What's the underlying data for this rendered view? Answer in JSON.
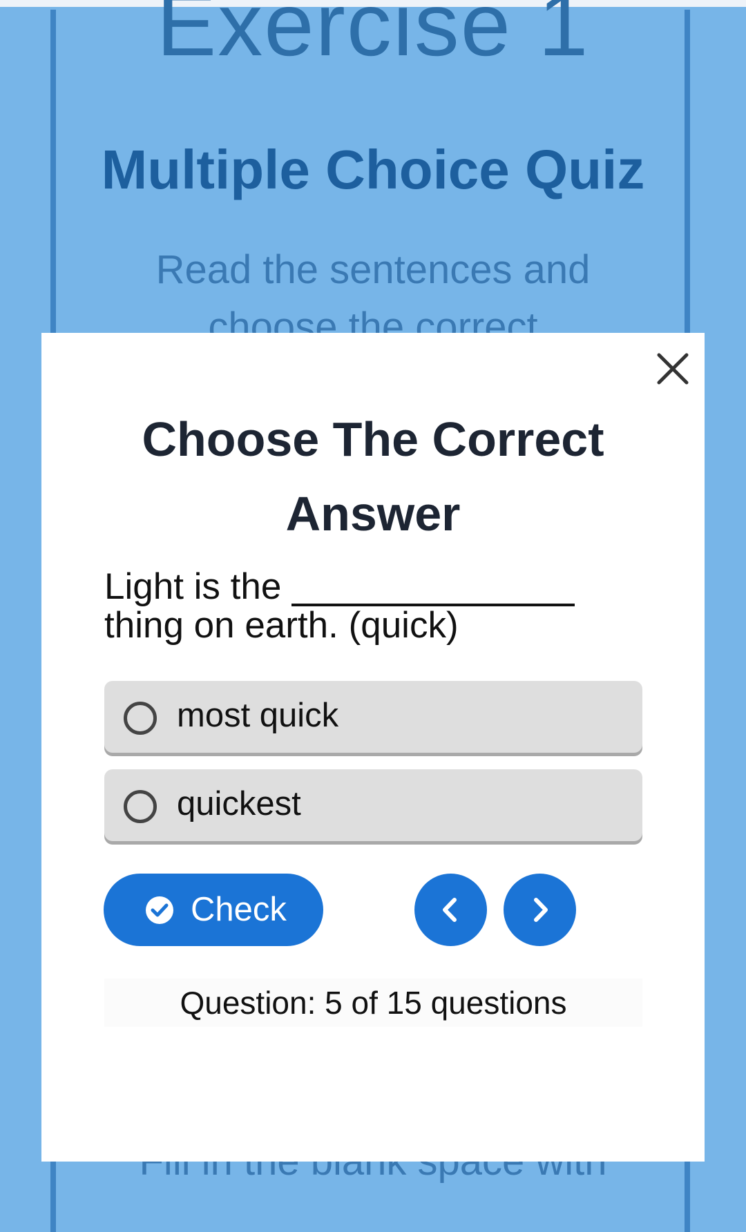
{
  "background": {
    "title": "Exercise 1",
    "subtitle": "Multiple Choice Quiz",
    "instruction_line1": "Read the sentences and",
    "instruction_line2": "choose the correct",
    "footer_text": "Fill in the blank space with"
  },
  "modal": {
    "close_icon": "close-icon",
    "title": "Choose The Correct Answer",
    "question_before": "Light is the",
    "question_after": "thing on earth. (quick)",
    "options": [
      {
        "label": "most quick",
        "selected": false
      },
      {
        "label": "quickest",
        "selected": false
      }
    ],
    "check_label": "Check",
    "check_icon": "check-circle-icon",
    "prev_icon": "chevron-left-icon",
    "next_icon": "chevron-right-icon",
    "progress_text": "Question: 5 of 15 questions"
  },
  "colors": {
    "page_bg": "#77b5e8",
    "accent": "#1b74d6",
    "option_bg": "#dedede"
  }
}
